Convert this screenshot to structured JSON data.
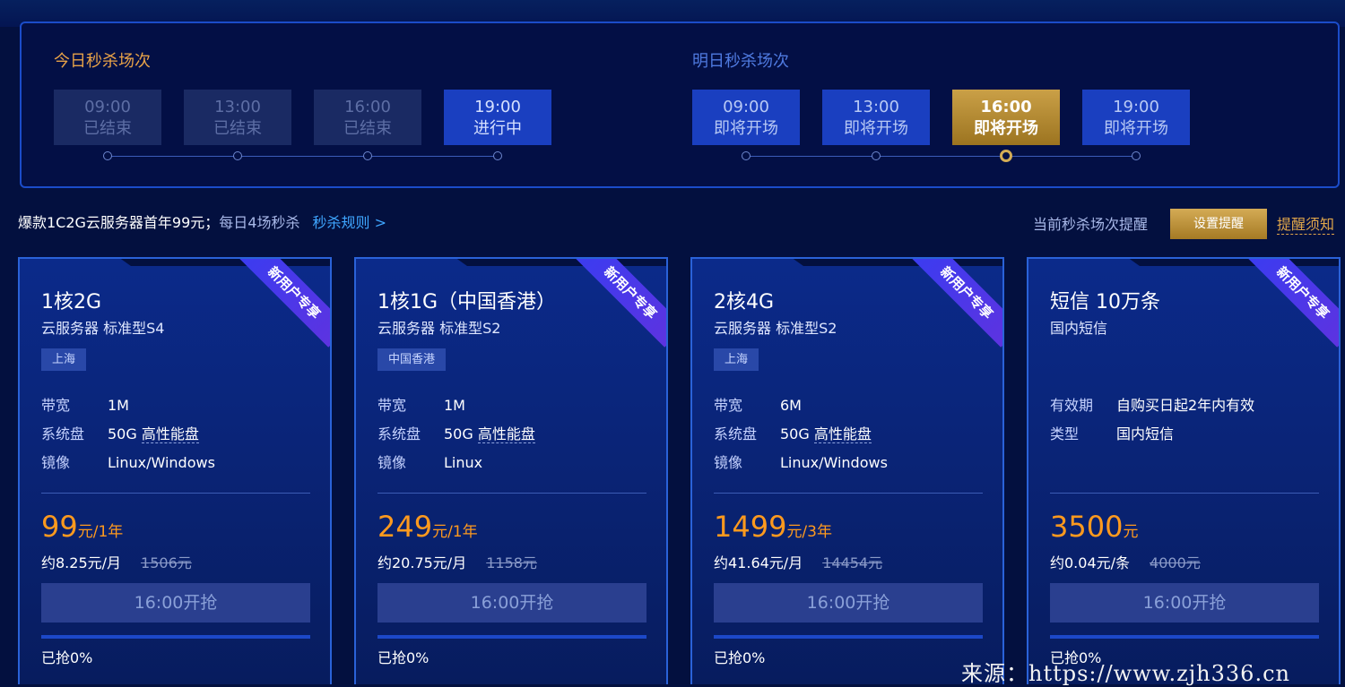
{
  "schedule": {
    "today_title": "今日秒杀场次",
    "tomorrow_title": "明日秒杀场次",
    "today": [
      {
        "time": "09:00",
        "status": "已结束"
      },
      {
        "time": "13:00",
        "status": "已结束"
      },
      {
        "time": "16:00",
        "status": "已结束"
      },
      {
        "time": "19:00",
        "status": "进行中"
      }
    ],
    "tomorrow": [
      {
        "time": "09:00",
        "status": "即将开场"
      },
      {
        "time": "13:00",
        "status": "即将开场"
      },
      {
        "time": "16:00",
        "status": "即将开场"
      },
      {
        "time": "19:00",
        "status": "即将开场"
      }
    ]
  },
  "promo": {
    "text1": "爆款1C2G云服务器首年99元；",
    "text2": "每日4场秒杀",
    "rules_link": "秒杀规则 >",
    "remind_label": "当前秒杀场次提醒",
    "remind_button": "设置提醒",
    "notice_link": "提醒须知"
  },
  "cards": [
    {
      "ribbon": "新用户专享",
      "title": "1核2G",
      "subtitle": "云服务器 标准型S4",
      "tag": "上海",
      "specs": [
        {
          "k": "带宽",
          "v": "1M",
          "u": ""
        },
        {
          "k": "系统盘",
          "v": "50G ",
          "u": "高性能盘"
        },
        {
          "k": "镜像",
          "v": "Linux/Windows",
          "u": ""
        }
      ],
      "price": "99",
      "price_unit": "元/1年",
      "monthly": "约8.25元/月",
      "original": "1506元",
      "button": "16:00开抢",
      "sold": "已抢0%"
    },
    {
      "ribbon": "新用户专享",
      "title": "1核1G（中国香港）",
      "subtitle": "云服务器 标准型S2",
      "tag": "中国香港",
      "specs": [
        {
          "k": "带宽",
          "v": "1M",
          "u": ""
        },
        {
          "k": "系统盘",
          "v": "50G ",
          "u": "高性能盘"
        },
        {
          "k": "镜像",
          "v": "Linux",
          "u": ""
        }
      ],
      "price": "249",
      "price_unit": "元/1年",
      "monthly": "约20.75元/月",
      "original": "1158元",
      "button": "16:00开抢",
      "sold": "已抢0%"
    },
    {
      "ribbon": "新用户专享",
      "title": "2核4G",
      "subtitle": "云服务器 标准型S2",
      "tag": "上海",
      "specs": [
        {
          "k": "带宽",
          "v": "6M",
          "u": ""
        },
        {
          "k": "系统盘",
          "v": "50G ",
          "u": "高性能盘"
        },
        {
          "k": "镜像",
          "v": "Linux/Windows",
          "u": ""
        }
      ],
      "price": "1499",
      "price_unit": "元/3年",
      "monthly": "约41.64元/月",
      "original": "14454元",
      "button": "16:00开抢",
      "sold": "已抢0%"
    },
    {
      "ribbon": "新用户专享",
      "title": "短信 10万条",
      "subtitle": "国内短信",
      "tag": "",
      "specs": [
        {
          "k": "有效期",
          "v": "自购买日起2年内有效",
          "u": ""
        },
        {
          "k": "类型",
          "v": "国内短信",
          "u": ""
        }
      ],
      "price": "3500",
      "price_unit": "元",
      "monthly": "约0.04元/条",
      "original": "4000元",
      "button": "16:00开抢",
      "sold": "已抢0%"
    }
  ],
  "watermark": "来源：https://www.zjh336.cn"
}
